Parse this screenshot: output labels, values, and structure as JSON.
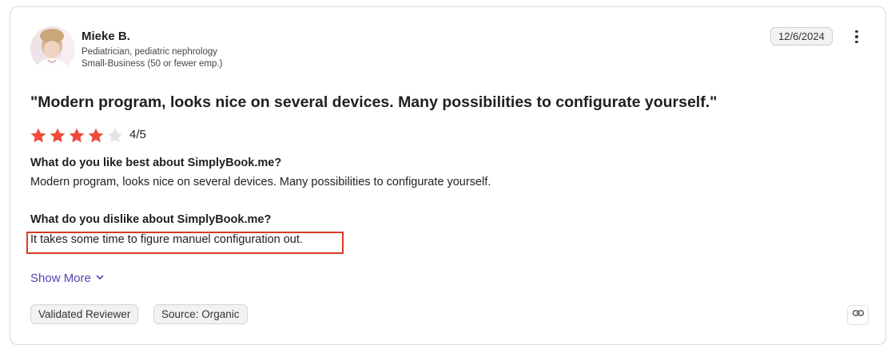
{
  "reviewer": {
    "name": "Mieke B.",
    "title": "Pediatrician, pediatric nephrology",
    "company_size": "Small-Business (50 or fewer emp.)"
  },
  "date": "12/6/2024",
  "review": {
    "title": "\"Modern program, looks nice on several devices. Many possibilities to configurate yourself.\"",
    "rating": 4,
    "rating_max": 5,
    "rating_label": "4/5",
    "questions": [
      {
        "heading": "What do you like best about SimplyBook.me?",
        "answer": "Modern program, looks nice on several devices. Many possibilities to configurate yourself."
      },
      {
        "heading": "What do you dislike about SimplyBook.me?",
        "answer": "It takes some time to figure manuel configuration out."
      }
    ]
  },
  "show_more_label": "Show More",
  "tags": [
    "Validated Reviewer",
    "Source: Organic"
  ],
  "icons": {
    "menu": "kebab-menu-icon",
    "chevron": "chevron-down-icon",
    "link": "link-icon",
    "star": "star-icon"
  },
  "colors": {
    "star_filled": "#ef4a3a",
    "star_empty": "#e3e3e3",
    "accent_link": "#5a3fb0",
    "highlight": "#d93a26"
  }
}
